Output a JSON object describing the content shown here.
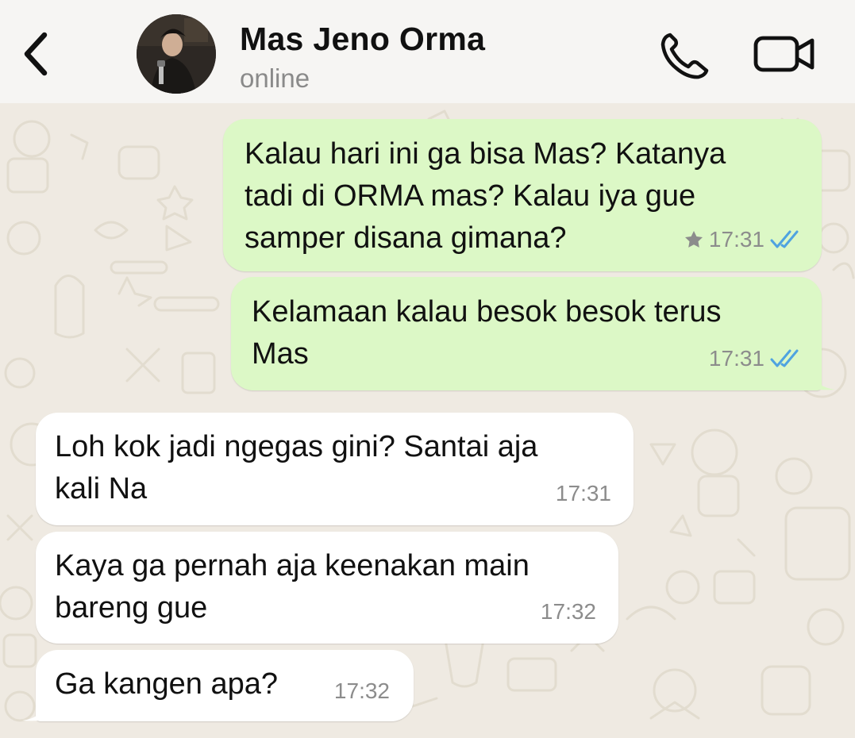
{
  "header": {
    "contact_name": "Mas Jeno Orma",
    "status": "online",
    "icons": {
      "back": "chevron-left-icon",
      "call": "phone-icon",
      "video": "video-camera-icon"
    }
  },
  "colors": {
    "outgoing_bubble": "#dcf8c6",
    "incoming_bubble": "#ffffff",
    "read_ticks": "#4fa3e0",
    "background": "#efeae2"
  },
  "messages": [
    {
      "direction": "outgoing",
      "text": "Kalau hari ini ga bisa Mas? Katanya\ntadi di ORMA mas? Kalau iya gue\nsamper disana gimana?",
      "time": "17:31",
      "starred": true,
      "read": true
    },
    {
      "direction": "outgoing",
      "text": "Kelamaan kalau besok besok terus\nMas",
      "time": "17:31",
      "starred": false,
      "read": true
    },
    {
      "direction": "incoming",
      "text": "Loh kok jadi ngegas gini? Santai aja\nkali Na",
      "time": "17:31"
    },
    {
      "direction": "incoming",
      "text": "Kaya ga pernah aja keenakan main\nbareng gue",
      "time": "17:32"
    },
    {
      "direction": "incoming",
      "text": "Ga kangen apa?",
      "time": "17:32"
    }
  ]
}
